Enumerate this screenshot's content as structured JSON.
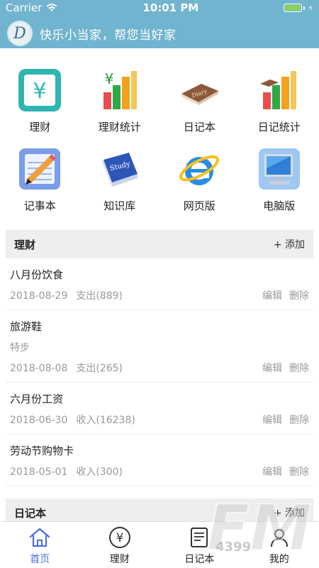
{
  "status": {
    "carrier": "Carrier",
    "time": "10:01 PM"
  },
  "header": {
    "logo_letter": "D",
    "title": "快乐小当家，帮您当好家"
  },
  "grid": [
    {
      "label": "理财",
      "icon": "yen-square-icon"
    },
    {
      "label": "理财统计",
      "icon": "bar-chart-yen-icon"
    },
    {
      "label": "日记本",
      "icon": "diary-book-icon"
    },
    {
      "label": "日记统计",
      "icon": "bar-chart-diary-icon"
    },
    {
      "label": "记事本",
      "icon": "notepad-pencil-icon"
    },
    {
      "label": "知识库",
      "icon": "study-book-icon"
    },
    {
      "label": "网页版",
      "icon": "internet-explorer-icon"
    },
    {
      "label": "电脑版",
      "icon": "desktop-computer-icon"
    }
  ],
  "finance_section": {
    "title": "理财",
    "add_label": "+ 添加",
    "items": [
      {
        "name": "八月份饮食",
        "note": "",
        "date": "2018-08-29",
        "amount": "支出(889)",
        "edit": "编辑",
        "delete": "删除"
      },
      {
        "name": "旅游鞋",
        "note": "特步",
        "date": "2018-08-08",
        "amount": "支出(265)",
        "edit": "编辑",
        "delete": "删除"
      },
      {
        "name": "六月份工资",
        "note": "",
        "date": "2018-06-30",
        "amount": "收入(16238)",
        "edit": "编辑",
        "delete": "删除"
      },
      {
        "name": "劳动节购物卡",
        "note": "",
        "date": "2018-05-01",
        "amount": "收入(300)",
        "edit": "编辑",
        "delete": "删除"
      }
    ]
  },
  "diary_section": {
    "title": "日记本",
    "add_label": "+ 添加"
  },
  "tabbar": {
    "tabs": [
      {
        "label": "首页",
        "icon": "home-icon",
        "active": true
      },
      {
        "label": "理财",
        "icon": "yen-circle-icon",
        "active": false
      },
      {
        "label": "日记本",
        "icon": "notebook-icon",
        "active": false
      },
      {
        "label": "我的",
        "icon": "user-icon",
        "active": false
      }
    ]
  },
  "watermark": {
    "text": "FM",
    "sub": "4399"
  },
  "colors": {
    "header_bg": "#71b4cf",
    "active_tab": "#4a6ee0",
    "muted_text": "#999999",
    "section_bg": "#eeeeee"
  }
}
